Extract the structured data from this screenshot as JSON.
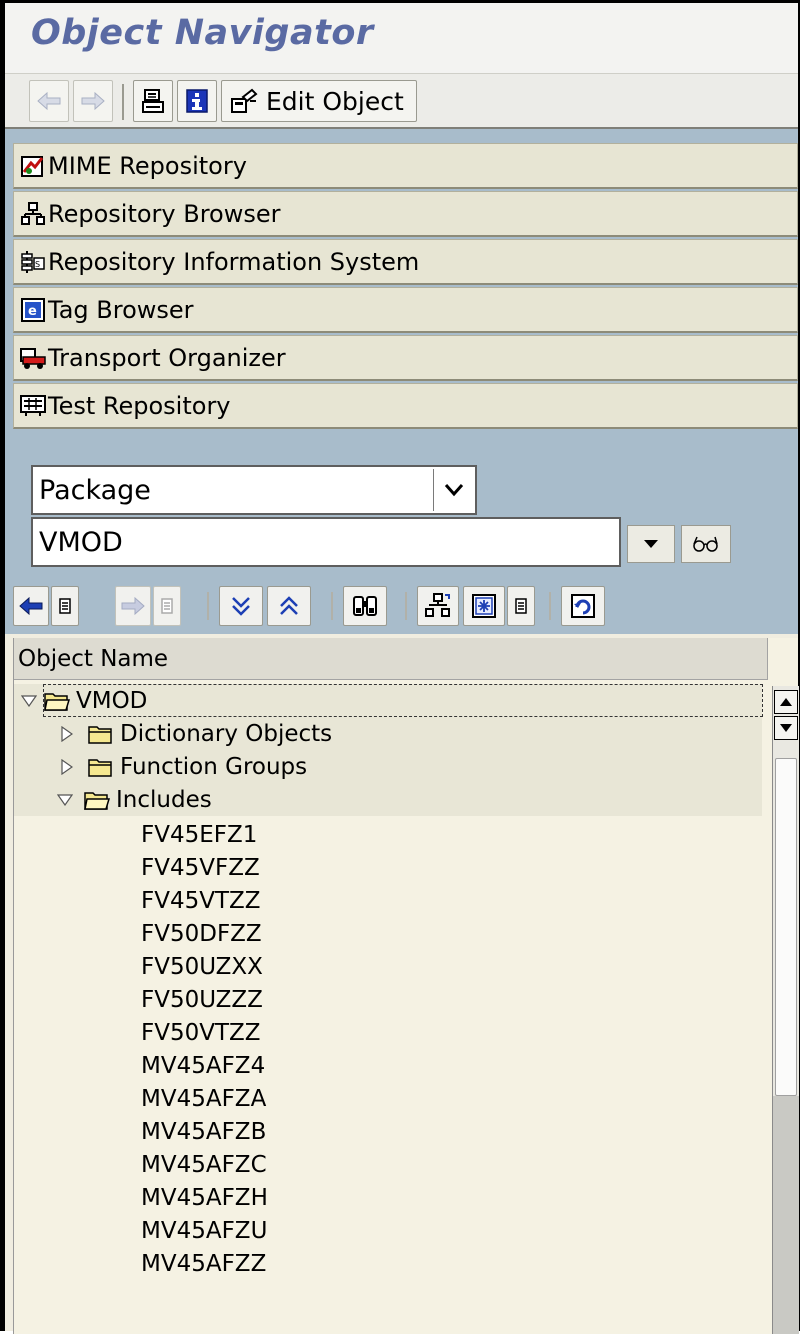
{
  "window": {
    "title": "Object Navigator"
  },
  "toolbar": {
    "edit_object_label": "Edit Object"
  },
  "nav_buttons": [
    {
      "label": "MIME Repository",
      "icon": "mime-repository-icon"
    },
    {
      "label": "Repository Browser",
      "icon": "repository-browser-icon"
    },
    {
      "label": "Repository Information System",
      "icon": "repository-info-system-icon"
    },
    {
      "label": "Tag Browser",
      "icon": "tag-browser-icon"
    },
    {
      "label": "Transport Organizer",
      "icon": "transport-organizer-icon"
    },
    {
      "label": "Test Repository",
      "icon": "test-repository-icon"
    }
  ],
  "object_selection": {
    "type_value": "Package",
    "name_value": "VMOD"
  },
  "tree": {
    "column_header": "Object Name",
    "root": {
      "label": "VMOD",
      "expanded": true
    },
    "children": [
      {
        "label": "Dictionary Objects",
        "expanded": false
      },
      {
        "label": "Function Groups",
        "expanded": false
      },
      {
        "label": "Includes",
        "expanded": true
      }
    ],
    "includes": [
      "FV45EFZ1",
      "FV45VFZZ",
      "FV45VTZZ",
      "FV50DFZZ",
      "FV50UZXX",
      "FV50UZZZ",
      "FV50VTZZ",
      "MV45AFZ4",
      "MV45AFZA",
      "MV45AFZB",
      "MV45AFZC",
      "MV45AFZH",
      "MV45AFZU",
      "MV45AFZZ"
    ]
  }
}
